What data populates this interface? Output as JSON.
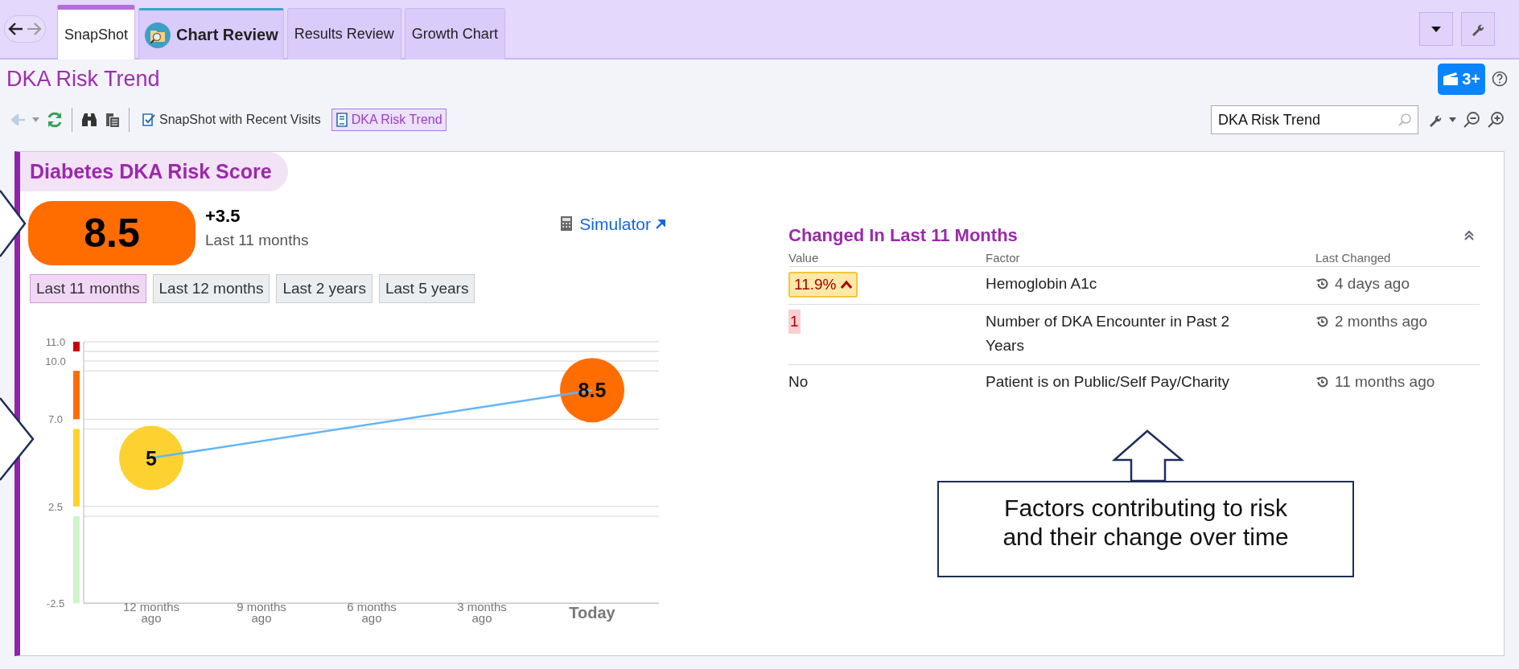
{
  "tabs": [
    {
      "label": "SnapShot",
      "selected": true,
      "kind": "plain"
    },
    {
      "label": "Chart Review",
      "selected": false,
      "kind": "activity"
    },
    {
      "label": "Results Review",
      "selected": false,
      "kind": "plain"
    },
    {
      "label": "Growth Chart",
      "selected": false,
      "kind": "plain"
    }
  ],
  "page_title": "DKA Risk Trend",
  "notification_badge": "3+",
  "toolbar": {
    "buttons": [
      {
        "label": "SnapShot with Recent Visits",
        "selected": false
      },
      {
        "label": "DKA Risk Trend",
        "selected": true
      }
    ],
    "search": {
      "value": "DKA Risk Trend"
    }
  },
  "card": {
    "title": "Diabetes DKA Risk Score",
    "score": "8.5",
    "change": "+3.5",
    "change_period": "Last 11 months",
    "simulator_link": "Simulator",
    "ranges": [
      {
        "label": "Last 11 months",
        "selected": true
      },
      {
        "label": "Last 12 months",
        "selected": false
      },
      {
        "label": "Last 2 years",
        "selected": false
      },
      {
        "label": "Last 5 years",
        "selected": false
      }
    ],
    "chart_data": {
      "type": "line",
      "categories": [
        "12 months ago",
        "9 months ago",
        "6 months ago",
        "3 months ago",
        "Today"
      ],
      "series": [
        {
          "color": "#64b5f6",
          "values": [
            5,
            null,
            null,
            null,
            8.5
          ]
        }
      ],
      "grid": true,
      "ylim": [
        -2.5,
        11
      ],
      "yticks": [
        {
          "value": 11,
          "label": "11.0"
        },
        {
          "value": 10,
          "label": "10.0"
        },
        {
          "value": 7,
          "label": "7.0"
        },
        {
          "value": 2.5,
          "label": "2.5"
        },
        {
          "value": -2.5,
          "label": "-2.5"
        }
      ],
      "data_labels": true
    },
    "risk_bands": [
      {
        "color": "#cc0000"
      },
      {
        "color": "#ff6d00"
      },
      {
        "color": "#fdd230"
      },
      {
        "color": "#ccf5c8"
      }
    ]
  },
  "changes": {
    "title": "Changed In Last 11 Months",
    "columns": [
      "Value",
      "Factor",
      "Last Changed"
    ],
    "rows": [
      {
        "value": "11.9%",
        "kind": "abnormal",
        "factor": "Hemoglobin A1c",
        "last_changed": "4 days ago"
      },
      {
        "value": "1",
        "kind": "changed",
        "factor": "Number of DKA Encounter in Past 2 Years",
        "last_changed": "2 months ago"
      },
      {
        "value": "No",
        "kind": "plain",
        "factor": "Patient is on Public/Self Pay/Charity",
        "last_changed": "11 months ago"
      }
    ]
  },
  "callout": {
    "text": "Factors contributing to risk and their change over time"
  }
}
